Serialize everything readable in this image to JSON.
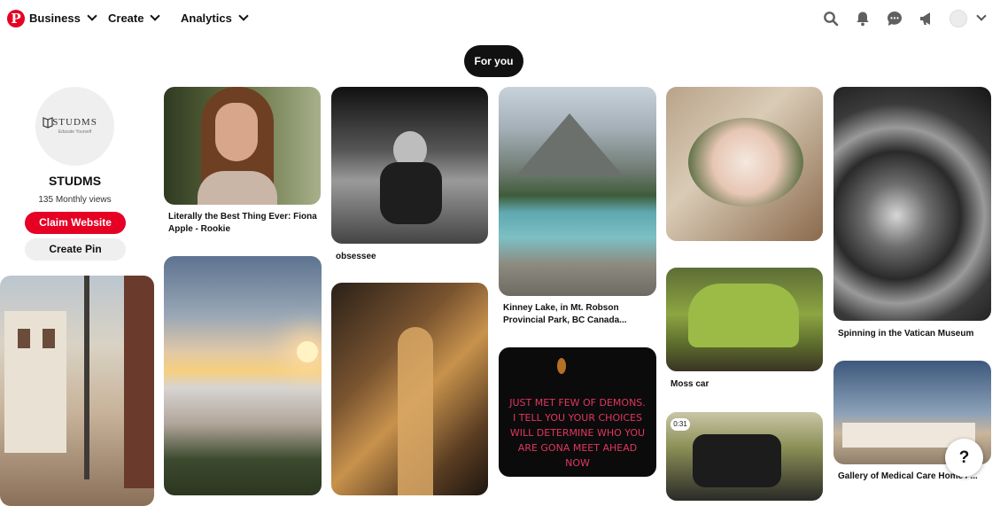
{
  "header": {
    "logo": "P",
    "nav": [
      "Business",
      "Create",
      "Analytics"
    ],
    "icons": [
      "search-icon",
      "bell-icon",
      "messages-icon",
      "megaphone-icon"
    ]
  },
  "feed_tab": "For you",
  "profile": {
    "brand": "STUDMS",
    "brand_tagline": "Educate Yourself",
    "name": "STUDMS",
    "monthly_views": "135 Monthly views",
    "claim_button": "Claim Website",
    "create_pin_button": "Create Pin"
  },
  "pins": {
    "fiona": "Literally the Best Thing Ever: Fiona Apple - Rookie",
    "obsessee": "obsessee",
    "kinney": "Kinney Lake, in Mt. Robson Provincial Park, BC Canada...",
    "mosscar": "Moss car",
    "vatican": "Spinning in the Vatican Museum",
    "gallery": "Gallery of Medical Care Home / ...",
    "demons_quote": "JUST MET FEW OF DEMONS. I TELL YOU YOUR CHOICES WILL DETERMINE WHO YOU ARE GONA MEET AHEAD NOW",
    "video_time": "0:31"
  },
  "help_label": "?"
}
